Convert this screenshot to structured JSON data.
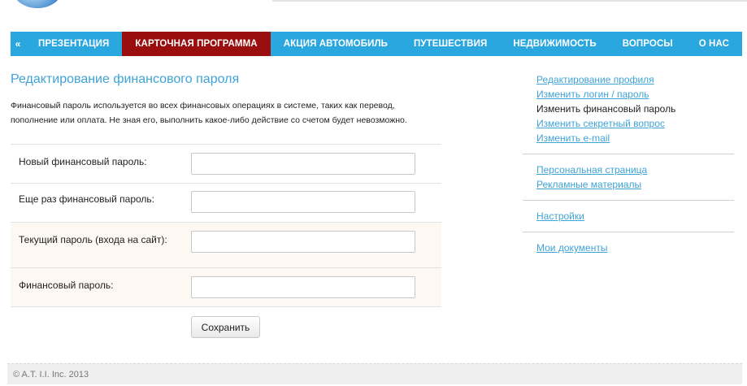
{
  "nav": {
    "items": [
      {
        "label": "«",
        "active": false
      },
      {
        "label": "ПРЕЗЕНТАЦИЯ",
        "active": false
      },
      {
        "label": "КАРТОЧНАЯ ПРОГРАММА",
        "active": true
      },
      {
        "label": "АКЦИЯ АВТОМОБИЛЬ",
        "active": false
      },
      {
        "label": "ПУТЕШЕСТВИЯ",
        "active": false
      },
      {
        "label": "НЕДВИЖИМОСТЬ",
        "active": false
      },
      {
        "label": "ВОПРОСЫ",
        "active": false
      },
      {
        "label": "О НАС",
        "active": false
      }
    ]
  },
  "main": {
    "title": "Редактирование финансового пароля",
    "description_line1": "Финансовый пароль используется во всех финансовых операциях в системе, таких как перевод,",
    "description_line2": "пополнение или оплата. Не зная его, выполнить какое-либо действие со счетом будет невозможно.",
    "fields": [
      {
        "label": "Новый финансовый пароль:",
        "value": ""
      },
      {
        "label": "Еще раз финансовый пароль:",
        "value": ""
      },
      {
        "label": "Текущий пароль (входа на сайт):",
        "value": ""
      },
      {
        "label": "Финансовый пароль:",
        "value": ""
      }
    ],
    "save_label": "Сохранить"
  },
  "sidebar": {
    "group1": [
      {
        "label": "Редактирование профиля",
        "current": false
      },
      {
        "label": "Изменить логин / пароль",
        "current": false
      },
      {
        "label": "Изменить финансовый пароль",
        "current": true
      },
      {
        "label": "Изменить секретный вопрос",
        "current": false
      },
      {
        "label": "Изменить e-mail",
        "current": false
      }
    ],
    "group2": [
      {
        "label": "Персональная страница"
      },
      {
        "label": "Рекламные материалы"
      }
    ],
    "group3": [
      {
        "label": "Настройки"
      }
    ],
    "group4": [
      {
        "label": "Мои документы"
      }
    ]
  },
  "footer": {
    "copyright": "© A.T. I.I. Inc. 2013"
  },
  "colors": {
    "nav_bg": "#2aa7df",
    "nav_active": "#9b0e0e",
    "link": "#3fa3d6"
  }
}
